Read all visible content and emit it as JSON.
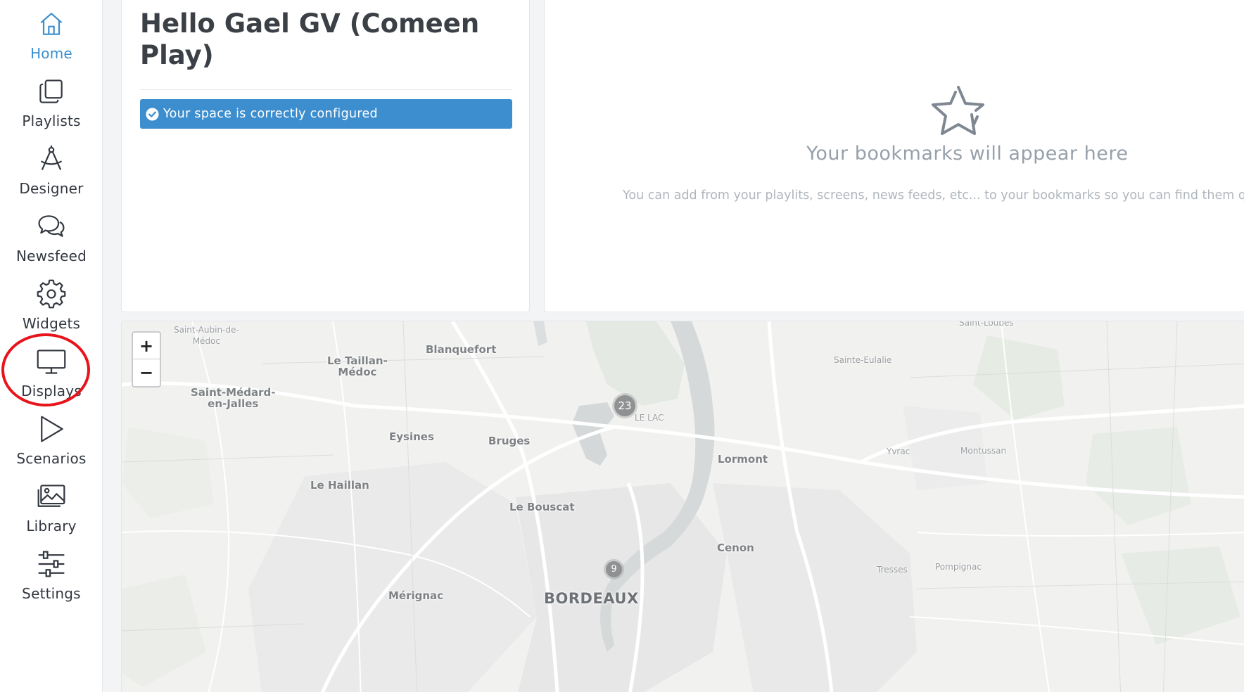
{
  "sidebar": {
    "items": [
      {
        "label": "Home",
        "icon": "home-icon",
        "active": true
      },
      {
        "label": "Playlists",
        "icon": "playlists-icon"
      },
      {
        "label": "Designer",
        "icon": "designer-compass-icon"
      },
      {
        "label": "Newsfeed",
        "icon": "chat-bubbles-icon"
      },
      {
        "label": "Widgets",
        "icon": "gear-icon"
      },
      {
        "label": "Displays",
        "icon": "monitor-icon"
      },
      {
        "label": "Scenarios",
        "icon": "play-icon"
      },
      {
        "label": "Library",
        "icon": "image-library-icon"
      },
      {
        "label": "Settings",
        "icon": "sliders-icon"
      }
    ],
    "highlighted_item": "Displays",
    "accent_color": "#3a8fd0",
    "annotation_color": "#e8141c"
  },
  "welcome": {
    "title": "Hello Gael GV (Comeen Play)",
    "status_text": "Your space is correctly configured",
    "status_color": "#3d8ecf"
  },
  "bookmarks": {
    "title": "Your bookmarks will appear here",
    "subtitle": "You can add from your playlits, screens, news feeds, etc... to your bookmarks so you can find them quickly."
  },
  "map": {
    "zoom_in_label": "+",
    "zoom_out_label": "−",
    "places": {
      "saint_aubin": "Saint-Aubin-de-\nMédoc",
      "blanquefort": "Blanquefort",
      "le_taillan": "Le Taillan-\nMédoc",
      "saint_medard": "Saint-Médard-\nen-Jalles",
      "saint_loubes": "Saint-Loubès",
      "sainte_eulalie": "Sainte-Eulalie",
      "le_lac": "LE LAC",
      "eysines": "Eysines",
      "bruges": "Bruges",
      "lormont": "Lormont",
      "yvrac": "Yvrac",
      "montussan": "Montussan",
      "le_haillan": "Le Haillan",
      "le_bouscat": "Le Bouscat",
      "cenon": "Cenon",
      "tresses": "Tresses",
      "pompignac": "Pompignac",
      "merignac": "Mérignac",
      "bordeaux": "BORDEAUX"
    },
    "clusters": [
      {
        "count": "23"
      },
      {
        "count": "9"
      }
    ]
  }
}
